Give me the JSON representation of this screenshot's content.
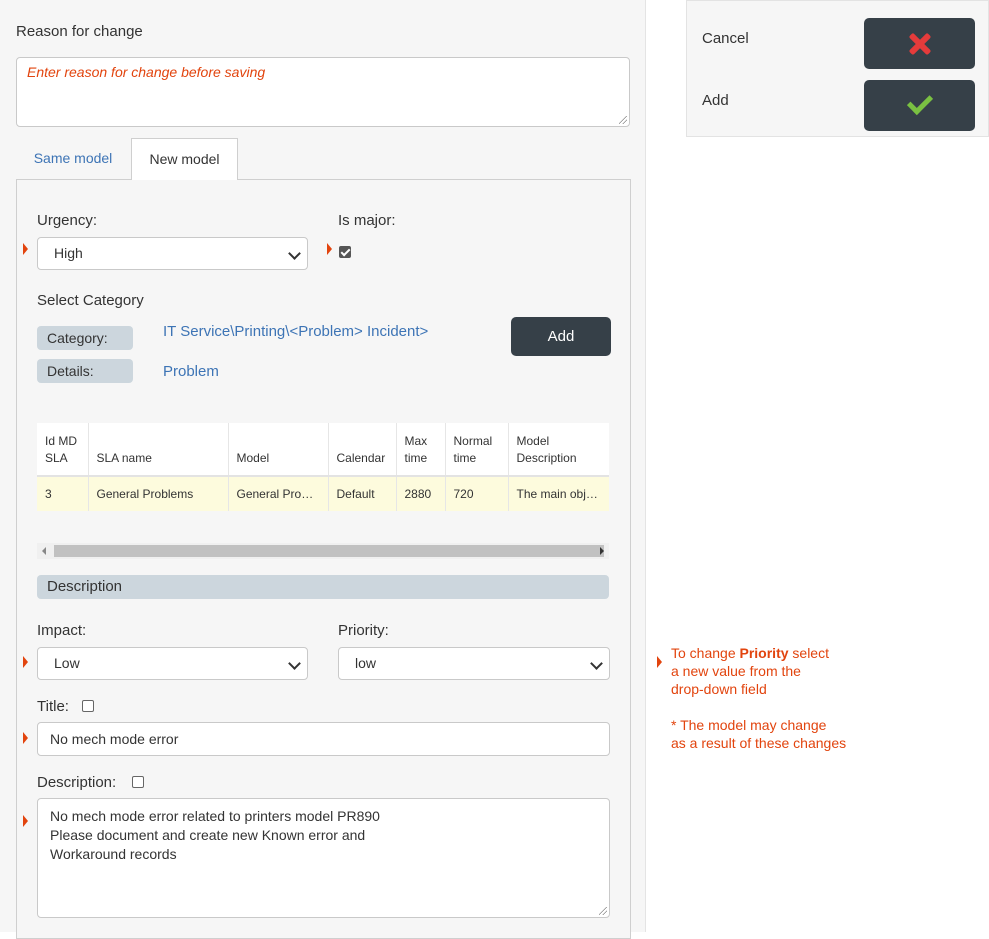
{
  "reason": {
    "label": "Reason for change",
    "placeholder": "Enter reason for change before saving"
  },
  "tabs": [
    {
      "label": "Same model",
      "active": false
    },
    {
      "label": "New model",
      "active": true
    }
  ],
  "urgency": {
    "label": "Urgency:",
    "value": "High"
  },
  "is_major": {
    "label": "Is major:",
    "checked": true
  },
  "category": {
    "section_label": "Select Category",
    "category_label": "Category:",
    "category_value": "IT Service\\Printing\\<Problem>  Incident>",
    "details_label": "Details:",
    "details_value": "Problem",
    "add_button": "Add"
  },
  "sla_table": {
    "columns": [
      [
        "Id MD",
        "SLA"
      ],
      [
        "SLA name"
      ],
      [
        "Model"
      ],
      [
        "Calendar"
      ],
      [
        "Max",
        "time"
      ],
      [
        "Normal",
        "time"
      ],
      [
        "Model",
        "Description"
      ]
    ],
    "rows": [
      [
        "3",
        "General Problems",
        "General Problems",
        "Default",
        "2880",
        "720",
        "The main objective"
      ]
    ]
  },
  "description_section": "Description",
  "impact": {
    "label": "Impact:",
    "value": "Low"
  },
  "priority": {
    "label": "Priority:",
    "value": "low"
  },
  "title": {
    "label": "Title:",
    "value": "No mech mode error"
  },
  "description": {
    "label": "Description:",
    "lines": [
      "No mech mode error related to printers model PR890",
      "Please document and create new Known error and",
      "Workaround records"
    ]
  },
  "actions": {
    "cancel_label": "Cancel",
    "add_label": "Add",
    "cancel_icon": "x-icon",
    "add_icon": "check-icon"
  },
  "hint": {
    "line1_pre": "To change ",
    "line1_bold": "Priority",
    "line1_post": " select",
    "line2": "a new value from the",
    "line3": "drop-down field",
    "note1": "* The model may change",
    "note2": "as a result of these changes"
  },
  "colors": {
    "accent": "#e2440e",
    "link": "#3d74b5",
    "dark_button": "#364048",
    "section_bar": "#ccd6dd",
    "row_highlight": "#fdfbdd"
  }
}
